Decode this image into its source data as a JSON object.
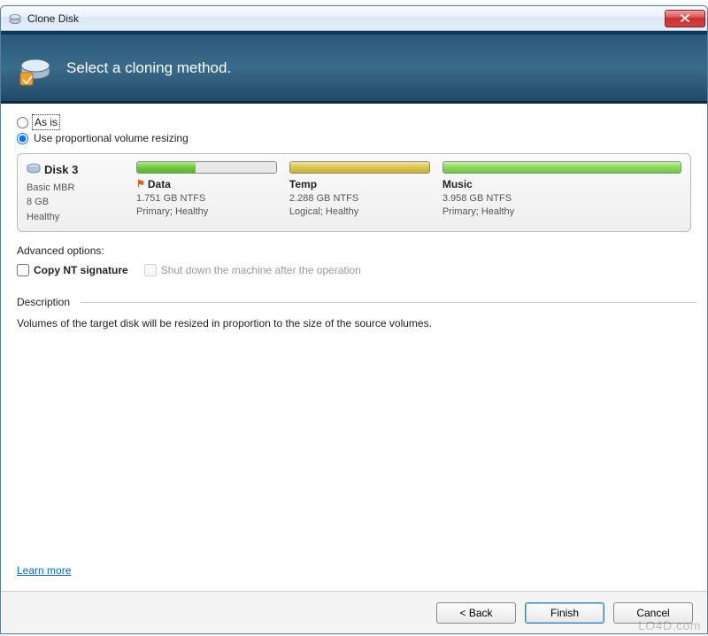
{
  "window": {
    "title": "Clone Disk",
    "close_label": "X"
  },
  "header": {
    "title": "Select a cloning method."
  },
  "options": {
    "as_is": "As is",
    "proportional": "Use proportional volume resizing",
    "selected": "proportional"
  },
  "disk": {
    "name": "Disk 3",
    "type": "Basic MBR",
    "size": "8 GB",
    "status": "Healthy"
  },
  "volumes": [
    {
      "name": "Data",
      "size": "1.751 GB NTFS",
      "status": "Primary; Healthy",
      "bar_class": "bar-green",
      "fill_pct": 42,
      "flag": true
    },
    {
      "name": "Temp",
      "size": "2.288 GB NTFS",
      "status": "Logical; Healthy",
      "bar_class": "bar-yellow",
      "fill_pct": 100,
      "flag": false
    },
    {
      "name": "Music",
      "size": "3.958 GB NTFS",
      "status": "Primary; Healthy",
      "bar_class": "bar-green-full",
      "fill_pct": 100,
      "flag": false
    }
  ],
  "advanced": {
    "label": "Advanced options:",
    "copy_nt": "Copy NT signature",
    "shutdown": "Shut down the machine after the operation"
  },
  "description": {
    "label": "Description",
    "text": "Volumes of the target disk will be resized in proportion to the size of the source volumes."
  },
  "links": {
    "learn_more": "Learn more"
  },
  "buttons": {
    "back": "< Back",
    "finish": "Finish",
    "cancel": "Cancel"
  },
  "watermark": "LO4D.com"
}
